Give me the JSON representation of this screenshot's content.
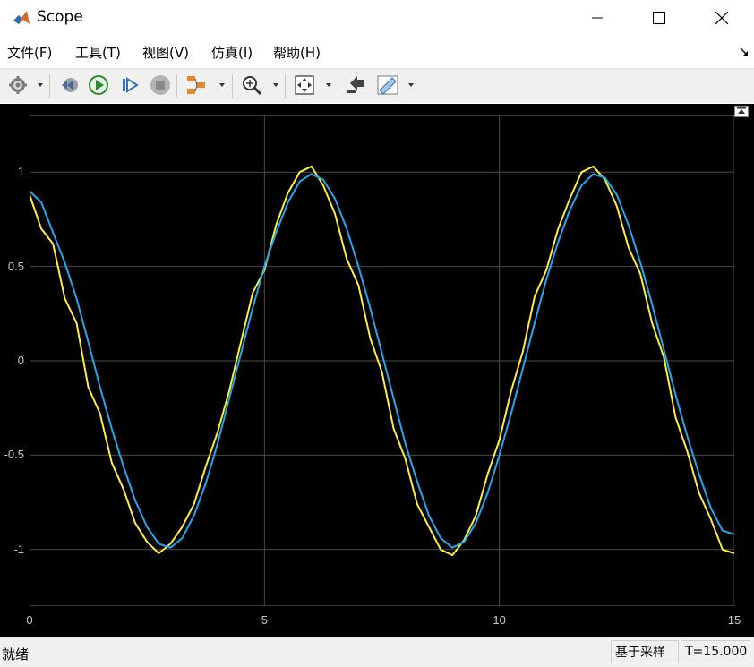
{
  "window": {
    "title": "Scope"
  },
  "menu": {
    "items": [
      {
        "label": "文件(F)"
      },
      {
        "label": "工具(T)"
      },
      {
        "label": "视图(V)"
      },
      {
        "label": "仿真(I)"
      },
      {
        "label": "帮助(H)"
      }
    ]
  },
  "toolbar": {
    "buttons": [
      "settings-icon",
      "step-back-icon",
      "run-icon",
      "step-forward-icon",
      "stop-icon",
      "signal-selector-icon",
      "zoom-icon",
      "fit-to-view-icon",
      "highlight-block-icon",
      "measurements-icon"
    ]
  },
  "status": {
    "left": "就绪",
    "mode": "基于采样",
    "time": "T=15.000"
  },
  "colors": {
    "plot_background": "#000000",
    "grid": "#4a4a4a",
    "series1": "#ffee33",
    "series2": "#1ea8ee",
    "tick_text": "#c8c8c8"
  },
  "chart_data": {
    "type": "line",
    "title": "",
    "xlabel": "",
    "ylabel": "",
    "xlim": [
      0,
      15
    ],
    "ylim": [
      -1.3,
      1.3
    ],
    "xticks": [
      0,
      5,
      10,
      15
    ],
    "xtick_labels": [
      "0",
      "5",
      "10",
      "15"
    ],
    "yticks": [
      1,
      0.5,
      0,
      -0.5,
      -1
    ],
    "ytick_labels": [
      "1",
      "0.5",
      "0",
      "-0.5",
      "-1"
    ],
    "grid": true,
    "series": [
      {
        "color": "#ffee33",
        "x": [
          0,
          0.25,
          0.5,
          0.75,
          1,
          1.25,
          1.5,
          1.75,
          2,
          2.25,
          2.5,
          2.75,
          3,
          3.25,
          3.5,
          3.75,
          4,
          4.25,
          4.5,
          4.75,
          5,
          5.25,
          5.5,
          5.75,
          6,
          6.25,
          6.5,
          6.75,
          7,
          7.25,
          7.5,
          7.75,
          8,
          8.25,
          8.5,
          8.75,
          9,
          9.25,
          9.5,
          9.75,
          10,
          10.25,
          10.5,
          10.75,
          11,
          11.25,
          11.5,
          11.75,
          12,
          12.25,
          12.5,
          12.75,
          13,
          13.25,
          13.5,
          13.75,
          14,
          14.25,
          14.5,
          14.75,
          15
        ],
        "values": [
          0.88,
          0.7,
          0.62,
          0.33,
          0.2,
          -0.14,
          -0.28,
          -0.54,
          -0.68,
          -0.86,
          -0.96,
          -1.02,
          -0.97,
          -0.88,
          -0.76,
          -0.56,
          -0.38,
          -0.16,
          0.1,
          0.36,
          0.48,
          0.72,
          0.89,
          1.0,
          1.03,
          0.93,
          0.78,
          0.54,
          0.4,
          0.12,
          -0.06,
          -0.36,
          -0.52,
          -0.76,
          -0.88,
          -1.0,
          -1.03,
          -0.95,
          -0.82,
          -0.6,
          -0.42,
          -0.16,
          0.05,
          0.34,
          0.48,
          0.7,
          0.86,
          1.0,
          1.03,
          0.96,
          0.82,
          0.6,
          0.46,
          0.2,
          0.02,
          -0.3,
          -0.48,
          -0.7,
          -0.84,
          -1.0,
          -1.02
        ]
      },
      {
        "color": "#1ea8ee",
        "x": [
          0,
          0.25,
          0.5,
          0.75,
          1,
          1.25,
          1.5,
          1.75,
          2,
          2.25,
          2.5,
          2.75,
          3,
          3.25,
          3.5,
          3.75,
          4,
          4.25,
          4.5,
          4.75,
          5,
          5.25,
          5.5,
          5.75,
          6,
          6.25,
          6.5,
          6.75,
          7,
          7.25,
          7.5,
          7.75,
          8,
          8.25,
          8.5,
          8.75,
          9,
          9.25,
          9.5,
          9.75,
          10,
          10.25,
          10.5,
          10.75,
          11,
          11.25,
          11.5,
          11.75,
          12,
          12.25,
          12.5,
          12.75,
          13,
          13.25,
          13.5,
          13.75,
          14,
          14.25,
          14.5,
          14.75,
          15
        ],
        "values": [
          0.9,
          0.84,
          0.68,
          0.52,
          0.33,
          0.1,
          -0.14,
          -0.36,
          -0.56,
          -0.74,
          -0.88,
          -0.97,
          -0.99,
          -0.94,
          -0.82,
          -0.65,
          -0.44,
          -0.2,
          0.04,
          0.28,
          0.5,
          0.68,
          0.84,
          0.95,
          0.99,
          0.96,
          0.86,
          0.7,
          0.5,
          0.28,
          0.04,
          -0.2,
          -0.44,
          -0.64,
          -0.82,
          -0.94,
          -0.99,
          -0.96,
          -0.86,
          -0.7,
          -0.5,
          -0.28,
          -0.04,
          0.2,
          0.43,
          0.63,
          0.8,
          0.93,
          0.99,
          0.97,
          0.88,
          0.72,
          0.52,
          0.3,
          0.06,
          -0.18,
          -0.4,
          -0.6,
          -0.78,
          -0.9,
          -0.92
        ]
      }
    ]
  }
}
